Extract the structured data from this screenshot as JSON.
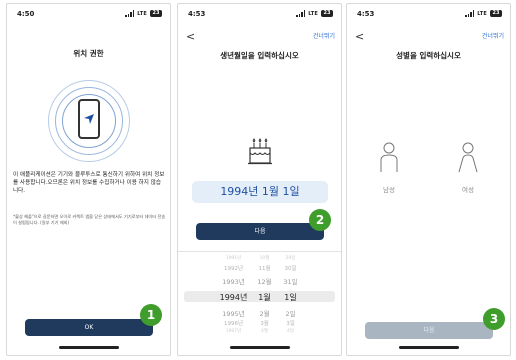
{
  "screen1": {
    "status_time": "4:50",
    "network": "LTE",
    "battery": "23",
    "title": "위치 권한",
    "body": "이 애플리케이션은 기기와 블루투스로 통신하기 위하여 위치 정보를 사용합니다.오므론은 위치 정보를 수집하거나 이용 하지 않습니다.",
    "note": "*블상 해플\"으로 길문하면 오이로 커렉트 앱을 닫은 상태에서도 기기로부터 데이터 전송이 설펌됩니다. (일부 기기 제외)",
    "button": "OK",
    "badge": "1"
  },
  "screen2": {
    "status_time": "4:53",
    "network": "LTE",
    "battery": "23",
    "back": "<",
    "skip": "건너뛰기",
    "title": "생년월일을 입력하십시오",
    "selected_date": "1994년 1월 1일",
    "button": "다음",
    "badge": "2",
    "picker": {
      "rows": [
        {
          "year": "1991년",
          "month": "10월",
          "day": "29일"
        },
        {
          "year": "1992년",
          "month": "11월",
          "day": "30일"
        },
        {
          "year": "1993년",
          "month": "12월",
          "day": "31일"
        },
        {
          "year": "1994년",
          "month": "1월",
          "day": "1일"
        },
        {
          "year": "1995년",
          "month": "2월",
          "day": "2일"
        },
        {
          "year": "1996년",
          "month": "3월",
          "day": "3일"
        },
        {
          "year": "1997년",
          "month": "4월",
          "day": "4일"
        }
      ]
    }
  },
  "screen3": {
    "status_time": "4:53",
    "network": "LTE",
    "battery": "23",
    "back": "<",
    "skip": "건너뛰기",
    "title": "성별을 입력하십시오",
    "male": "남성",
    "female": "여성",
    "button": "다음",
    "badge": "3"
  },
  "colors": {
    "primary_button": "#203a5e",
    "disabled_button": "#a9b5c1",
    "badge": "#3f9d2b",
    "link": "#2b6fd6",
    "date_text": "#1f4fa0"
  }
}
